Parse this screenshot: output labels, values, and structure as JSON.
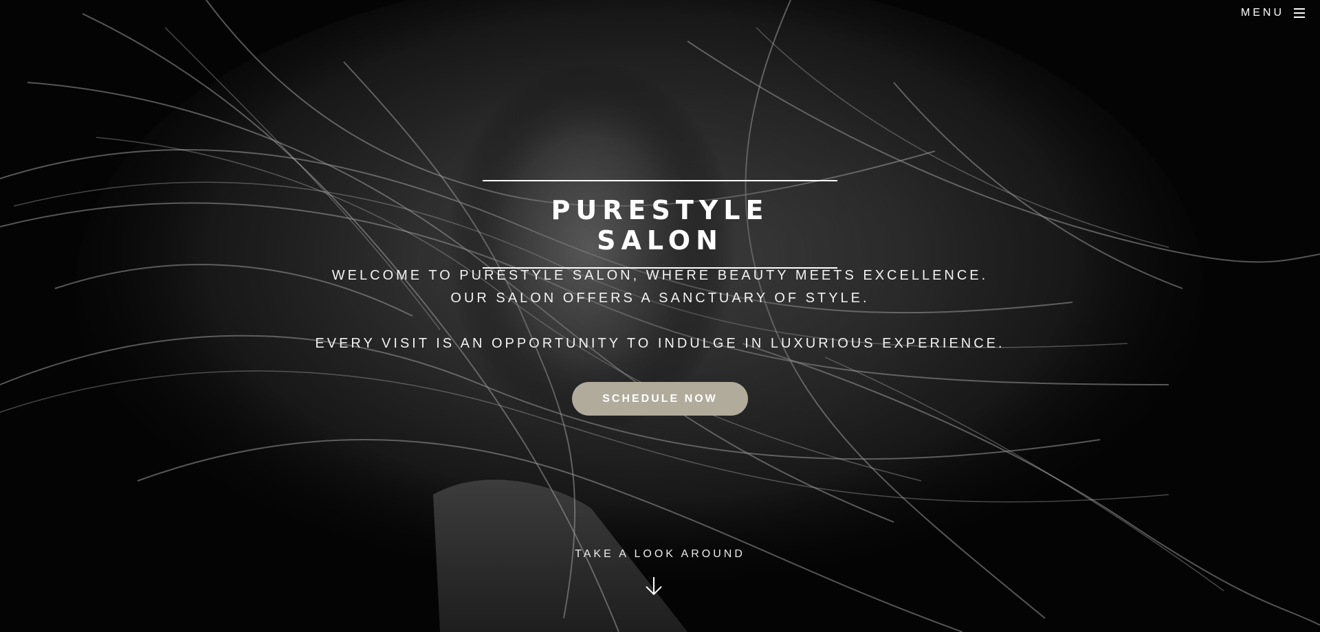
{
  "header": {
    "menu_label": "MENU",
    "menu_icon": "hamburger-icon"
  },
  "hero": {
    "title": "PURESTYLE SALON",
    "intro_line_1": "WELCOME TO PURESTYLE SALON, WHERE BEAUTY MEETS EXCELLENCE.",
    "intro_line_2": "OUR SALON OFFERS A SANCTUARY OF STYLE.",
    "intro_line_3": "EVERY VISIT IS AN OPPORTUNITY TO INDULGE IN LUXURIOUS EXPERIENCE.",
    "cta_label": "SCHEDULE NOW",
    "scroll_label": "TAKE A LOOK AROUND",
    "scroll_icon": "arrow-down-icon"
  },
  "colors": {
    "background": "#000000",
    "text": "#ffffff",
    "cta_background": "#b0ab9b"
  }
}
